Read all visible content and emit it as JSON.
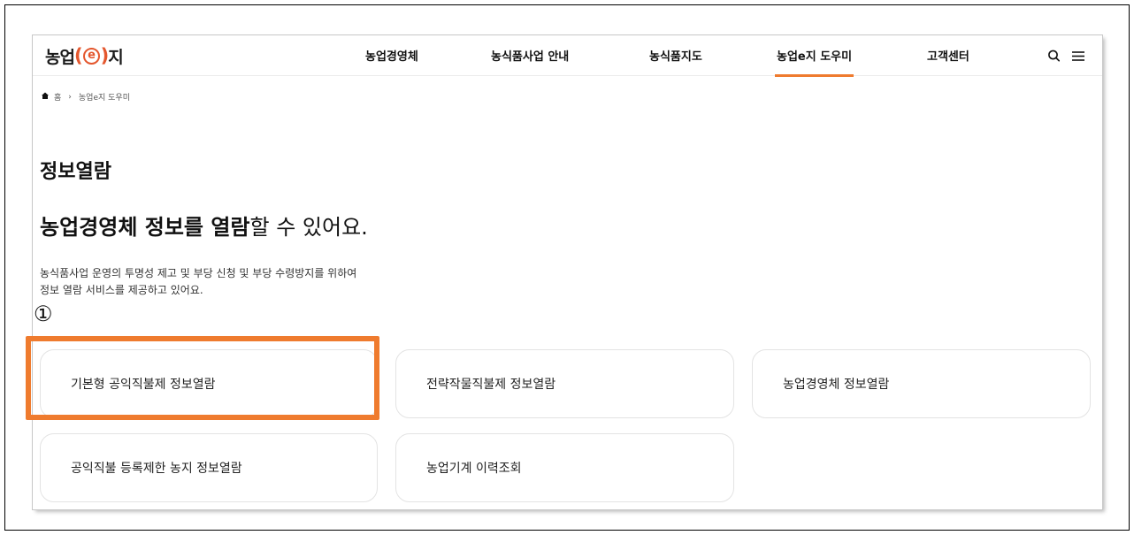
{
  "header": {
    "logo_part_a": "농업",
    "logo_e": "e",
    "logo_part_b": "지",
    "nav": [
      {
        "label": "농업경영체"
      },
      {
        "label": "농식품사업 안내"
      },
      {
        "label": "농식품지도"
      },
      {
        "label": "농업e지 도우미",
        "active": true
      },
      {
        "label": "고객센터"
      }
    ],
    "icons": [
      "search-icon",
      "hamburger-menu-icon"
    ]
  },
  "breadcrumb": {
    "home": "홈",
    "current": "농업e지 도우미"
  },
  "main": {
    "title": "정보열람",
    "headline_bold": "농업경영체 정보를 열람",
    "headline_rest": "할 수 있어요.",
    "desc_line1": "농식품사업 운영의 투명성 제고 및 부당 신청 및 부당 수령방지를 위하여",
    "desc_line2": "정보 열람 서비스를 제공하고 있어요.",
    "cards": [
      {
        "label": "기본형 공익직불제 정보열람"
      },
      {
        "label": "전략작물직불제 정보열람"
      },
      {
        "label": "농업경영체 정보열람"
      },
      {
        "label": "공익직불 등록제한 농지 정보열람"
      },
      {
        "label": "농업기계 이력조회"
      }
    ]
  },
  "annotation": {
    "marker": "①",
    "highlight_color": "#ef7b2e"
  },
  "colors": {
    "accent": "#ef7b2e",
    "logo_accent": "#e4572e"
  }
}
